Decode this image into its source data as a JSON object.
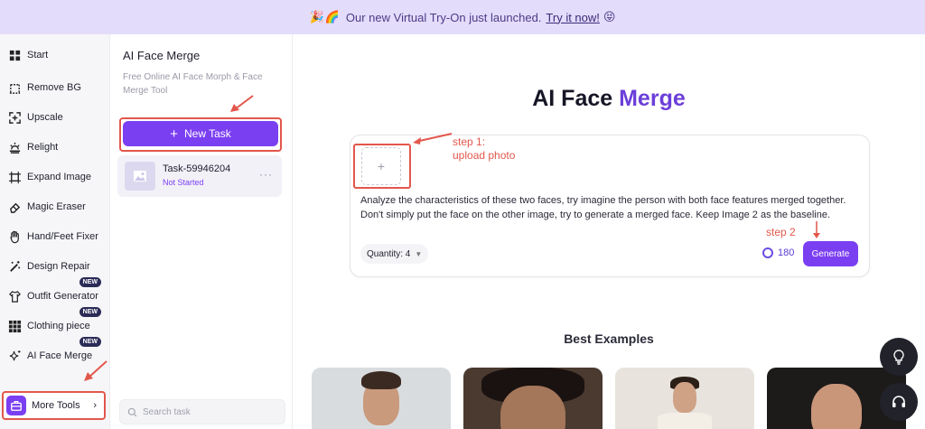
{
  "banner": {
    "emoji": "🎉🌈",
    "text": "Our new Virtual Try-On just launched.",
    "link": "Try it now!",
    "emoji_end": "😝"
  },
  "sidebar": {
    "items": [
      {
        "label": "Start",
        "icon": "grid-icon"
      },
      {
        "label": "Remove BG",
        "icon": "remove-bg-icon"
      },
      {
        "label": "Upscale",
        "icon": "upscale-icon"
      },
      {
        "label": "Relight",
        "icon": "relight-icon"
      },
      {
        "label": "Expand Image",
        "icon": "expand-icon"
      },
      {
        "label": "Magic Eraser",
        "icon": "eraser-icon"
      },
      {
        "label": "Hand/Feet Fixer",
        "icon": "hand-icon"
      },
      {
        "label": "Design Repair",
        "icon": "wand-icon"
      },
      {
        "label": "Outfit Generator",
        "icon": "shirt-icon",
        "badge": "NEW"
      },
      {
        "label": "Clothing piece",
        "icon": "pieces-icon",
        "badge": "NEW"
      },
      {
        "label": "AI Face Merge",
        "icon": "sparkle-icon",
        "badge": "NEW"
      }
    ],
    "more_tools": "More Tools",
    "more_tools_chevron": "›"
  },
  "panel": {
    "title": "AI Face Merge",
    "subtitle": "Free Online AI Face Morph & Face Merge Tool",
    "new_task_icon": "+",
    "new_task": "New Task",
    "task": {
      "name": "Task-59946204",
      "status": "Not Started",
      "more": "···"
    },
    "search_placeholder": "Search task"
  },
  "main": {
    "title_part1": "AI Face ",
    "title_part2": "Merge",
    "upload_plus": "+",
    "prompt": "Analyze the characteristics of these two faces, try imagine the person with both face features merged together. Don't simply put the face on the other image, try to generate a merged face. Keep Image 2 as the baseline.",
    "quantity": "Quantity: 4",
    "credits": "180",
    "generate": "Generate",
    "best_examples": "Best Examples"
  },
  "annotations": {
    "step1_line1": "step 1:",
    "step1_line2": "upload photo",
    "step2": "step 2"
  },
  "colors": {
    "accent": "#7b3ff2",
    "annotation_red": "#e2574c",
    "banner_bg": "#e4dcfb"
  }
}
